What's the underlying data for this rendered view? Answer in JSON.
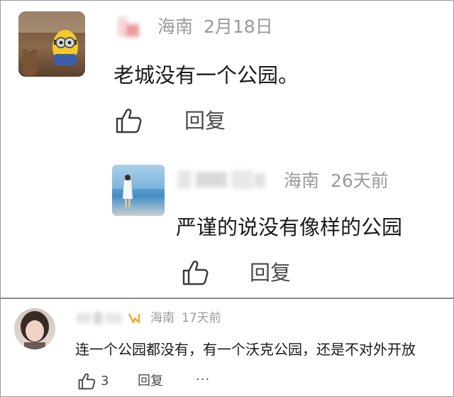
{
  "comments": [
    {
      "location": "海南",
      "time": "2月18日",
      "text": "老城没有一个公园。",
      "reply_label": "回复"
    },
    {
      "location": "海南",
      "time": "26天前",
      "text": "严谨的说没有像样的公园",
      "reply_label": "回复"
    },
    {
      "location": "海南",
      "time": "17天前",
      "text": "连一个公园都没有，有一个沃克公园，还是不对外开放",
      "like_count": "3",
      "reply_label": "回复",
      "more_label": "···"
    }
  ],
  "icons": [
    "thumbs-up-icon",
    "more-icon",
    "badge-icon"
  ],
  "colors": {
    "meta_text": "#9a9a9a",
    "body_text": "#1a1a1a",
    "divider": "#8c8c8c",
    "badge": "#f2a531"
  }
}
